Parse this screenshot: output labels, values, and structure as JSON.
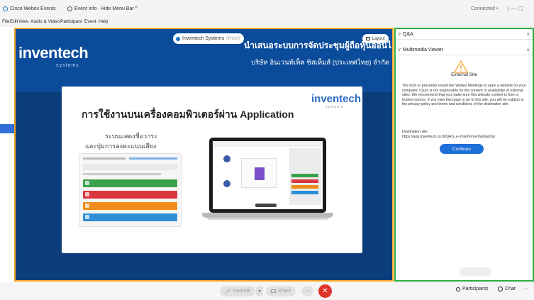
{
  "titlebar": {
    "app_name": "Cisco Webex Events",
    "event_info": "Event Info",
    "hide_menu": "Hide Menu Bar ^",
    "status": "Connected •",
    "win_controls": "| — ☐"
  },
  "menu": [
    "File",
    "Edit",
    "View",
    "Audio & Video",
    "Participant",
    "Event",
    "Help"
  ],
  "stage": {
    "logo": "inventech",
    "logo_sub": "systems",
    "host_name": "Inventech Systems",
    "host_role": "(Host)",
    "layout_label": "Layout",
    "header_title": "นำเสนอระบบการจัดประชุมผู้ถือหุ้นออนไลน์",
    "header_subtitle": "บริษัท อินเวนท์เท็ค ซิสเท็มส์ (ประเทศไทย) จำกัด",
    "slide": {
      "logo": "inventech",
      "logo_sub": "systems",
      "title": "การใช้งานบนเครื่องคอมพิวเตอร์ผ่าน Application",
      "caption_line1": "ระบบแสดงชื่อวาระ",
      "caption_line2": "และปุ่มการลงคะแนนเสียง"
    }
  },
  "panel": {
    "qa_label": "Q&A",
    "mm_label": "Multimedia Viewer",
    "close": "×",
    "external_title": "External Site",
    "external_body": "The host or presenter would like Webex Meetings to open a website on your computer. Cisco is not responsible for the content or availability of external sites. We recommend that you make sure this website content is from a trusted source. If you view this page or go to this site, you will be subject to the privacy policy and terms and conditions of the destination site.",
    "dest_label": "Destination site:",
    "dest_url": "https://app.inventech.co.th/QAS_e-Vote/home/loginportal",
    "continue_label": "Continue"
  },
  "toolbar": {
    "unmute_label": "Unmute",
    "share_label": "Share",
    "more_label": "···",
    "end_label": "✕",
    "participants_label": "Participants",
    "chat_label": "Chat",
    "overflow_label": "···"
  },
  "colors": {
    "stage_border": "#f5a623",
    "panel_border": "#2eaa3f",
    "header_blue": "#0a4b9a",
    "end_red": "#e0352b",
    "continue_blue": "#1f6fd8"
  }
}
